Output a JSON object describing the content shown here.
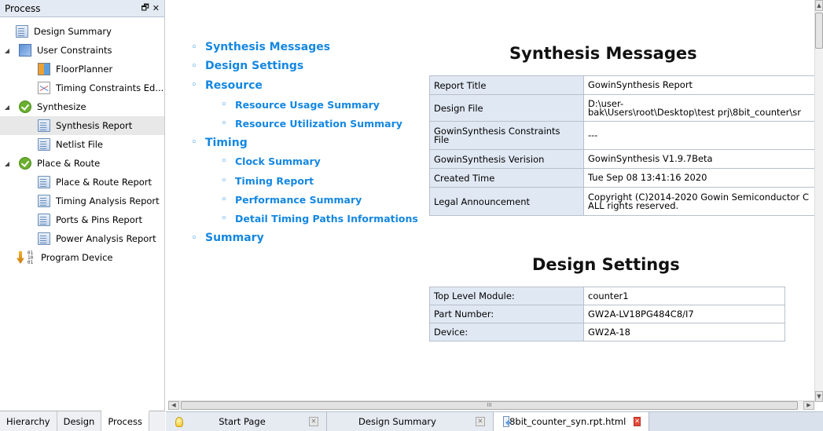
{
  "left_panel": {
    "title": "Process",
    "controls": {
      "float": "🗗",
      "close": "✕"
    },
    "tree": [
      {
        "label": "Design Summary",
        "icon": "document-icon",
        "level": 0,
        "expandable": false
      },
      {
        "label": "User Constraints",
        "icon": "constraints-icon",
        "level": 0,
        "expandable": true
      },
      {
        "label": "FloorPlanner",
        "icon": "floorplanner-icon",
        "level": 1
      },
      {
        "label": "Timing Constraints Ed...",
        "icon": "timing-constraints-icon",
        "level": 1
      },
      {
        "label": "Synthesize",
        "icon": "check-icon",
        "level": 0,
        "expandable": true
      },
      {
        "label": "Synthesis Report",
        "icon": "report-icon",
        "level": 1,
        "selected": true
      },
      {
        "label": "Netlist File",
        "icon": "report-icon",
        "level": 1
      },
      {
        "label": "Place & Route",
        "icon": "check-icon",
        "level": 0,
        "expandable": true
      },
      {
        "label": "Place & Route Report",
        "icon": "report-icon",
        "level": 1
      },
      {
        "label": "Timing Analysis Report",
        "icon": "report-icon",
        "level": 1
      },
      {
        "label": "Ports & Pins Report",
        "icon": "report-icon",
        "level": 1
      },
      {
        "label": "Power Analysis Report",
        "icon": "report-icon",
        "level": 1
      },
      {
        "label": "Program Device",
        "icon": "program-device-icon",
        "level": 0,
        "expandable": false
      }
    ],
    "tabs": [
      "Hierarchy",
      "Design",
      "Process"
    ],
    "active_tab": "Process"
  },
  "toc": {
    "items": [
      {
        "label": "Synthesis Messages",
        "level": 1
      },
      {
        "label": "Design Settings",
        "level": 1
      },
      {
        "label": "Resource",
        "level": 1
      },
      {
        "label": "Resource Usage Summary",
        "level": 2
      },
      {
        "label": "Resource Utilization Summary",
        "level": 2
      },
      {
        "label": "Timing",
        "level": 1
      },
      {
        "label": "Clock Summary",
        "level": 2
      },
      {
        "label": "Timing Report",
        "level": 2
      },
      {
        "label": "Performance Summary",
        "level": 2
      },
      {
        "label": "Detail Timing Paths Informations",
        "level": 2
      },
      {
        "label": "Summary",
        "level": 1
      }
    ]
  },
  "synthesis_messages": {
    "title": "Synthesis Messages",
    "rows": [
      {
        "key": "Report Title",
        "value": "GowinSynthesis Report"
      },
      {
        "key": "Design File",
        "value": "D:\\user-\nbak\\Users\\root\\Desktop\\test prj\\8bit_counter\\sr"
      },
      {
        "key": "GowinSynthesis Constraints\nFile",
        "value": "---"
      },
      {
        "key": "GowinSynthesis Verision",
        "value": "GowinSynthesis V1.9.7Beta"
      },
      {
        "key": "Created Time",
        "value": "Tue Sep 08 13:41:16 2020"
      },
      {
        "key": "Legal Announcement",
        "value": "Copyright (C)2014-2020 Gowin Semiconductor C\nALL rights reserved."
      }
    ]
  },
  "design_settings": {
    "title": "Design Settings",
    "rows": [
      {
        "key": "Top Level Module:",
        "value": "counter1"
      },
      {
        "key": "Part Number:",
        "value": "GW2A-LV18PG484C8/I7"
      },
      {
        "key": "Device:",
        "value": "GW2A-18"
      }
    ]
  },
  "doc_tabs": [
    {
      "label": "Start Page",
      "icon": "lightbulb-icon",
      "active": false
    },
    {
      "label": "Design Summary",
      "icon": "",
      "active": false
    },
    {
      "label": "8bit_counter_syn.rpt.html",
      "icon": "html-file-icon",
      "active": true
    }
  ],
  "scrollbar": {
    "h_thumb_grip": "III"
  },
  "colors": {
    "link": "#1487e2",
    "table_key_bg": "#e0e8f3",
    "panel_header": "#e4eaf3"
  }
}
